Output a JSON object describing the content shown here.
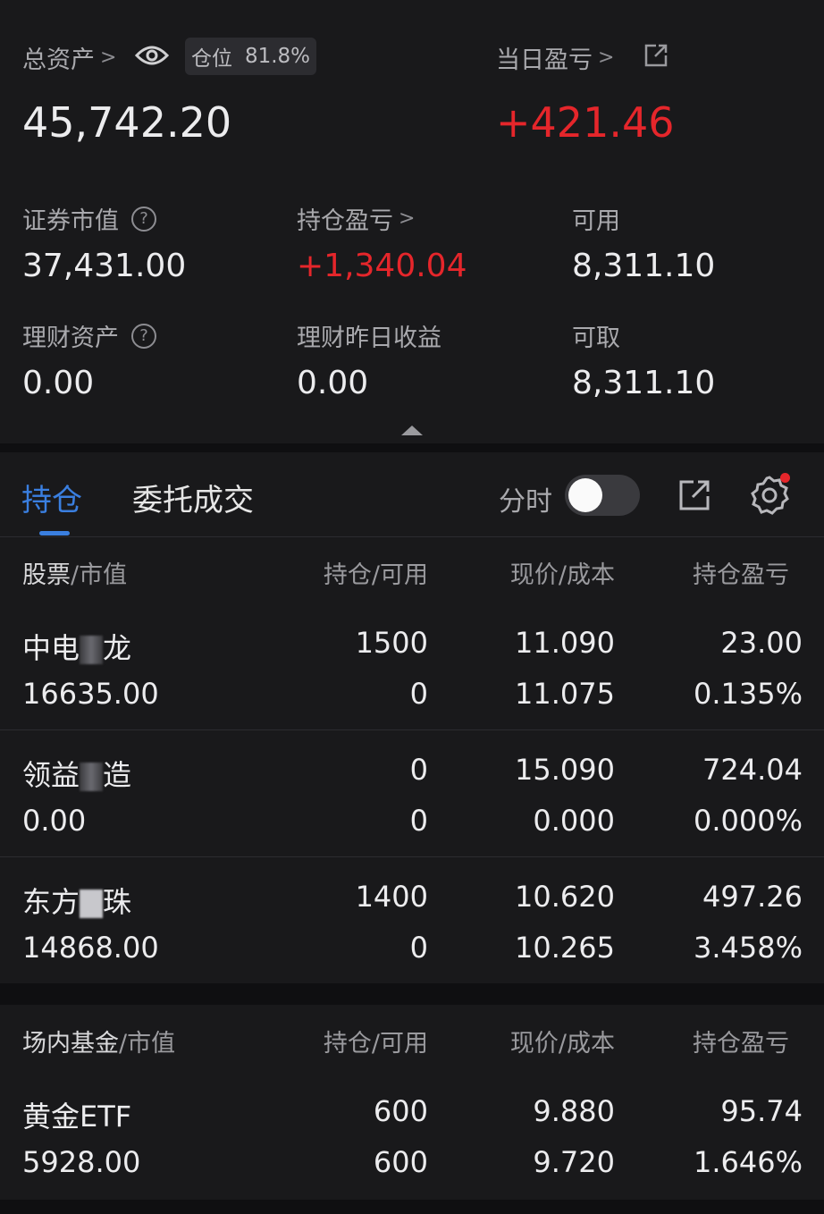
{
  "summary": {
    "total_assets_label": "总资产",
    "position_label": "仓位",
    "position_value": "81.8%",
    "total_assets_value": "45,742.20",
    "daily_pnl_label": "当日盈亏",
    "daily_pnl_value": "+421.46",
    "securities_value_label": "证券市值",
    "securities_value": "37,431.00",
    "holding_pnl_label": "持仓盈亏",
    "holding_pnl_value": "+1,340.04",
    "available_label": "可用",
    "available_value": "8,311.10",
    "wealth_assets_label": "理财资产",
    "wealth_assets_value": "0.00",
    "wealth_yesterday_label": "理财昨日收益",
    "wealth_yesterday_value": "0.00",
    "withdrawable_label": "可取",
    "withdrawable_value": "8,311.10"
  },
  "tabs": {
    "holdings": "持仓",
    "orders": "委托成交",
    "timeshare_label": "分时"
  },
  "stocks_header": {
    "col1_a": "股票",
    "col1_b": "/市值",
    "col2": "持仓/可用",
    "col3": "现价/成本",
    "col4": "持仓盈亏"
  },
  "stocks": [
    {
      "name_a": "中电",
      "name_b": "龙",
      "market_value": "16635.00",
      "position": "1500",
      "available": "0",
      "price": "11.090",
      "cost": "11.075",
      "pnl": "23.00",
      "pnl_pct": "0.135%"
    },
    {
      "name_a": "领益",
      "name_b": "造",
      "market_value": "0.00",
      "position": "0",
      "available": "0",
      "price": "15.090",
      "cost": "0.000",
      "pnl": "724.04",
      "pnl_pct": "0.000%"
    },
    {
      "name_a": "东方",
      "name_b": "珠",
      "market_value": "14868.00",
      "position": "1400",
      "available": "0",
      "price": "10.620",
      "cost": "10.265",
      "pnl": "497.26",
      "pnl_pct": "3.458%"
    }
  ],
  "funds_header": {
    "col1_a": "场内基金",
    "col1_b": "/市值",
    "col2": "持仓/可用",
    "col3": "现价/成本",
    "col4": "持仓盈亏"
  },
  "funds": [
    {
      "name": "黄金ETF",
      "market_value": "5928.00",
      "position": "600",
      "available": "600",
      "price": "9.880",
      "cost": "9.720",
      "pnl": "95.74",
      "pnl_pct": "1.646%"
    }
  ],
  "colors": {
    "accent": "#3a7fe0",
    "gain": "#e5262b",
    "notification": "#e5262b"
  }
}
